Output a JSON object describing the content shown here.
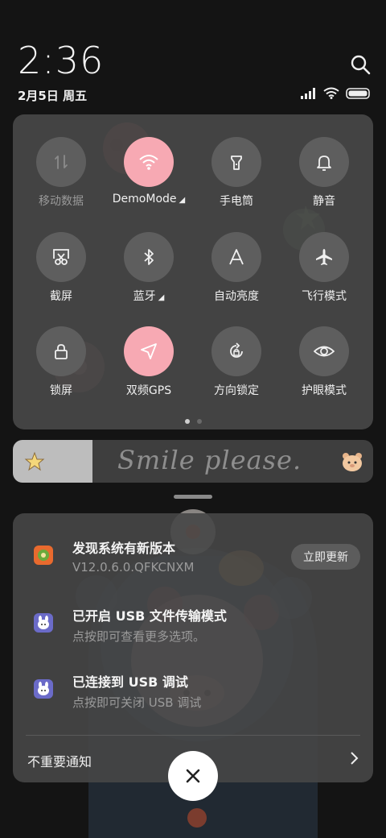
{
  "status": {
    "time": "2:36",
    "date": "2月5日 周五"
  },
  "quick_settings": {
    "tiles": [
      {
        "label": "移动数据",
        "icon": "mobile-data-icon",
        "state": "disabled"
      },
      {
        "label": "DemoMode",
        "icon": "wifi-icon",
        "state": "on",
        "expandable": true
      },
      {
        "label": "手电筒",
        "icon": "flashlight-icon",
        "state": "off"
      },
      {
        "label": "静音",
        "icon": "bell-icon",
        "state": "off"
      },
      {
        "label": "截屏",
        "icon": "screenshot-icon",
        "state": "off"
      },
      {
        "label": "蓝牙",
        "icon": "bluetooth-icon",
        "state": "off",
        "expandable": true
      },
      {
        "label": "自动亮度",
        "icon": "auto-brightness-icon",
        "state": "off"
      },
      {
        "label": "飞行模式",
        "icon": "airplane-icon",
        "state": "off"
      },
      {
        "label": "锁屏",
        "icon": "lock-icon",
        "state": "off"
      },
      {
        "label": "双频GPS",
        "icon": "location-icon",
        "state": "on"
      },
      {
        "label": "方向锁定",
        "icon": "rotation-lock-icon",
        "state": "off"
      },
      {
        "label": "护眼模式",
        "icon": "eye-icon",
        "state": "off"
      }
    ],
    "expand_marker": "◢",
    "page_count": 2,
    "current_page": 1
  },
  "brightness": {
    "level": 0.22,
    "text": "Smile please."
  },
  "notifications": [
    {
      "title": "发现系统有新版本",
      "subtitle": "V12.0.6.0.QFKCNXM",
      "icon": "updater-app-icon",
      "action": "立即更新"
    },
    {
      "title": "已开启 USB 文件传输模式",
      "subtitle": "点按即可查看更多选项。",
      "icon": "android-system-icon"
    },
    {
      "title": "已连接到 USB 调试",
      "subtitle": "点按即可关闭 USB 调试",
      "icon": "android-system-icon"
    }
  ],
  "footer": {
    "unimportant_label": "不重要通知"
  },
  "colors": {
    "accent_on": "#f7a9b3",
    "tile_off": "#5e5e5e",
    "panel": "#484848"
  }
}
